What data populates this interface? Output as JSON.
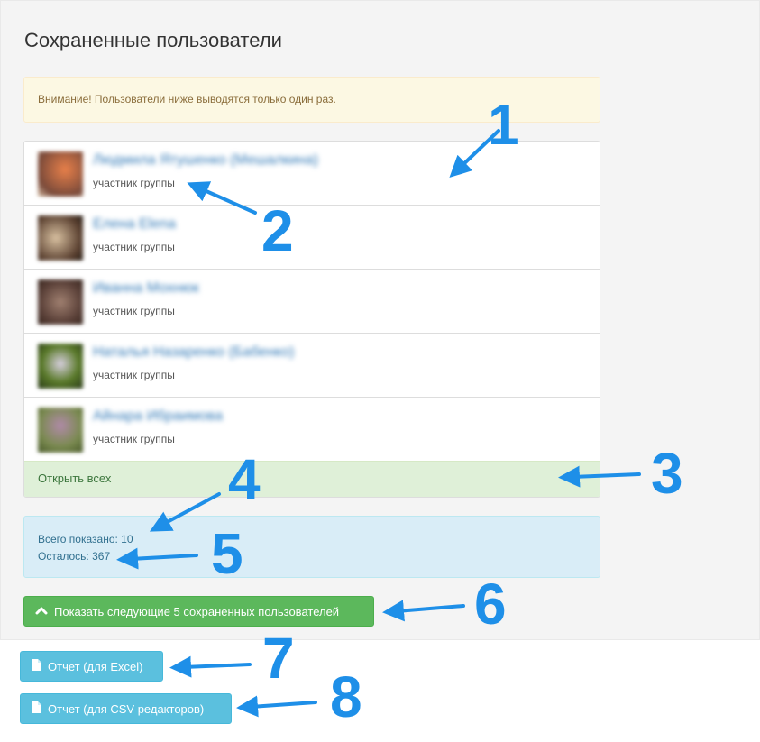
{
  "page": {
    "title": "Сохраненные пользователи"
  },
  "warning": {
    "text": "Внимание! Пользователи ниже выводятся только один раз."
  },
  "users": [
    {
      "name": "Людмила Ятушенко (Мешалкина)",
      "role": "участник группы",
      "avatar_color": "#c9703a"
    },
    {
      "name": "Елена Elena",
      "role": "участник группы",
      "avatar_color": "#8a6a4a"
    },
    {
      "name": "Иванна Мохнюк",
      "role": "участник группы",
      "avatar_color": "#6b5045"
    },
    {
      "name": "Наталья Назаренко (Бабенко)",
      "role": "участник группы",
      "avatar_color": "#4f6a2a"
    },
    {
      "name": "Айнара Ибраимова",
      "role": "участник группы",
      "avatar_color": "#7a8a4a"
    }
  ],
  "open_all": {
    "label": "Открыть всех"
  },
  "stats": {
    "shown": "Всего показано: 10",
    "remaining": "Осталось: 367"
  },
  "buttons": {
    "show_next": "Показать следующие 5 сохраненных пользователей",
    "report_excel": "Отчет (для Excel)",
    "report_csv": "Отчет (для CSV редакторов)"
  },
  "annotations": [
    "1",
    "2",
    "3",
    "4",
    "5",
    "6",
    "7",
    "8"
  ],
  "colors": {
    "annotation": "#1e8fe8",
    "success": "#5cb85c",
    "info": "#5bc0de",
    "link": "#337ab7"
  }
}
